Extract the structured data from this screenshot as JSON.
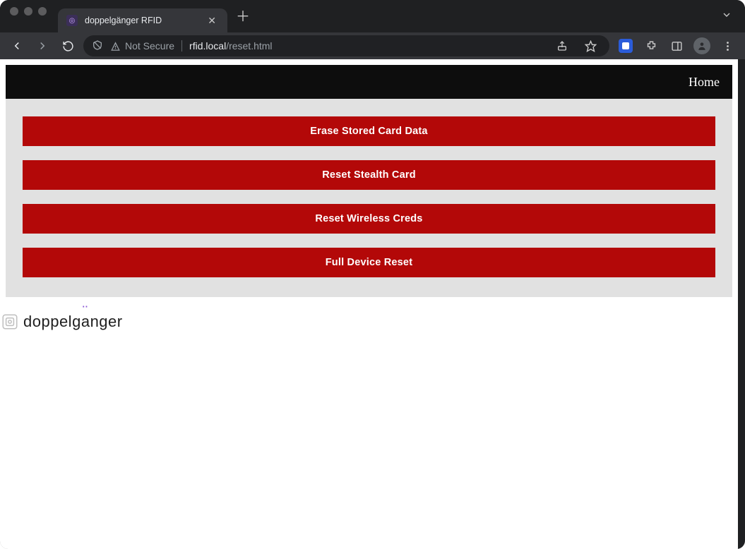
{
  "browser": {
    "tab_title": "doppelgänger RFID",
    "security_label": "Not Secure",
    "url_host": "rfid.local",
    "url_path": "/reset.html"
  },
  "nav": {
    "home_label": "Home"
  },
  "buttons": {
    "erase": "Erase Stored Card Data",
    "stealth": "Reset Stealth Card",
    "wireless": "Reset Wireless Creds",
    "full": "Full Device Reset"
  },
  "footer": {
    "brand": "doppelg",
    "brand_suffix": "nger"
  },
  "colors": {
    "button_bg": "#b30808",
    "page_bg": "#e1e1e1",
    "nav_bg": "#0d0d0d"
  }
}
